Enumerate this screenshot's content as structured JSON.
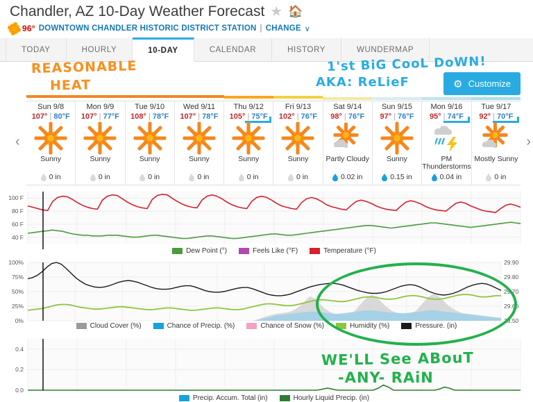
{
  "header": {
    "title": "Chandler, AZ 10-Day Weather Forecast",
    "star_icon": "star-icon",
    "home_icon": "home-icon",
    "current_temp": "96°",
    "station": "DOWNTOWN CHANDLER HISTORIC DISTRICT STATION",
    "separator": "|",
    "change_label": "CHANGE",
    "caret": "∨"
  },
  "tabs": [
    {
      "label": "TODAY",
      "active": false
    },
    {
      "label": "HOURLY",
      "active": false
    },
    {
      "label": "10-DAY",
      "active": true
    },
    {
      "label": "CALENDAR",
      "active": false
    },
    {
      "label": "HISTORY",
      "active": false
    },
    {
      "label": "WUNDERMAP",
      "active": false
    }
  ],
  "customize": {
    "label": "Customize",
    "icon": "gear-icon",
    "color": "#29abe2"
  },
  "nav": {
    "prev": "‹",
    "next": "›"
  },
  "annotations": [
    {
      "id": "reasonable",
      "text": "REASONABLE",
      "color": "#f7901e"
    },
    {
      "id": "heat",
      "text": "HEAT",
      "color": "#f7901e"
    },
    {
      "id": "cooldown",
      "text": "1'st BiG CooL DoWN!",
      "color": "#29abe2"
    },
    {
      "id": "relief",
      "text": "AKA: ReLieF",
      "color": "#29abe2"
    },
    {
      "id": "rain1",
      "text": "WE'LL See ABouT",
      "color": "#22b14c"
    },
    {
      "id": "rain2",
      "text": "-ANY- RAiN",
      "color": "#22b14c"
    }
  ],
  "forecast": {
    "days": [
      {
        "name": "Sun 9/8",
        "high": "107°",
        "low": "80°F",
        "condition": "Sunny",
        "precip": "0 in",
        "icon": "sun-icon",
        "precip_active": false,
        "marked": false
      },
      {
        "name": "Mon 9/9",
        "high": "107°",
        "low": "77°F",
        "condition": "Sunny",
        "precip": "0 in",
        "icon": "sun-icon",
        "precip_active": false,
        "marked": false
      },
      {
        "name": "Tue 9/10",
        "high": "108°",
        "low": "78°F",
        "condition": "Sunny",
        "precip": "0 in",
        "icon": "sun-icon",
        "precip_active": false,
        "marked": false
      },
      {
        "name": "Wed 9/11",
        "high": "107°",
        "low": "78°F",
        "condition": "Sunny",
        "precip": "0 in",
        "icon": "sun-icon",
        "precip_active": false,
        "marked": false
      },
      {
        "name": "Thu 9/12",
        "high": "105°",
        "low": "75°F",
        "condition": "Sunny",
        "precip": "0 in",
        "icon": "sun-icon",
        "precip_active": false,
        "marked": true
      },
      {
        "name": "Fri 9/13",
        "high": "102°",
        "low": "76°F",
        "condition": "Sunny",
        "precip": "0 in",
        "icon": "sun-icon",
        "precip_active": false,
        "marked": false
      },
      {
        "name": "Sat 9/14",
        "high": "98°",
        "low": "76°F",
        "condition": "Partly Cloudy",
        "precip": "0.02 in",
        "icon": "sun-cloud-icon",
        "precip_active": true,
        "marked": false
      },
      {
        "name": "Sun 9/15",
        "high": "97°",
        "low": "76°F",
        "condition": "Sunny",
        "precip": "0.15 in",
        "icon": "sun-icon",
        "precip_active": true,
        "marked": false
      },
      {
        "name": "Mon 9/16",
        "high": "95°",
        "low": "74°F",
        "condition": "PM Thunderstorms",
        "precip": "0.04 in",
        "icon": "thunderstorm-icon",
        "precip_active": true,
        "marked": true
      },
      {
        "name": "Tue 9/17",
        "high": "92°",
        "low": "70°F",
        "condition": "Mostly Sunny",
        "precip": "0 in",
        "icon": "sun-cloud-icon",
        "precip_active": false,
        "marked": true
      }
    ]
  },
  "chart_data": [
    {
      "id": "temperature-chart",
      "type": "line",
      "title": "",
      "xlabel": "",
      "ylabel": "",
      "ylim": [
        30,
        110
      ],
      "yticks": [
        "100 F",
        "80 F",
        "60 F",
        "40 F"
      ],
      "ytick_values": [
        100,
        80,
        60,
        40
      ],
      "grid": true,
      "legend_position": "bottom",
      "legend": [
        {
          "name": "Dew Point (°)",
          "color": "#4a9c3e"
        },
        {
          "name": "Feels Like (°F)",
          "color": "#b248b2"
        },
        {
          "name": "Temperature (°F)",
          "color": "#d6202c"
        }
      ],
      "series": [
        {
          "name": "Temperature (°F)",
          "color": "#d6202c",
          "values": [
            88,
            86,
            84,
            82,
            81,
            95,
            101,
            103,
            102,
            98,
            93,
            89,
            86,
            84,
            83,
            97,
            103,
            105,
            104,
            99,
            94,
            90,
            87,
            85,
            84,
            98,
            104,
            106,
            105,
            100,
            95,
            91,
            88,
            86,
            85,
            97,
            103,
            105,
            103,
            99,
            94,
            90,
            87,
            85,
            84,
            95,
            101,
            103,
            101,
            97,
            92,
            88,
            86,
            84,
            83,
            93,
            99,
            101,
            99,
            95,
            90,
            87,
            85,
            83,
            82,
            89,
            95,
            97,
            95,
            92,
            88,
            85,
            83,
            82,
            81,
            88,
            94,
            96,
            94,
            91,
            87,
            84,
            82,
            81,
            80,
            86,
            92,
            94,
            92,
            88,
            85,
            82,
            80,
            79,
            78,
            84,
            89,
            91,
            89,
            86
          ]
        },
        {
          "name": "Dew Point (°)",
          "color": "#4a9c3e",
          "values": [
            46,
            47,
            48,
            49,
            50,
            51,
            50,
            49,
            47,
            45,
            44,
            43,
            43,
            42,
            42,
            42,
            43,
            43,
            43,
            42,
            41,
            40,
            40,
            41,
            42,
            43,
            43,
            42,
            41,
            40,
            39,
            38,
            38,
            39,
            40,
            41,
            42,
            42,
            41,
            40,
            39,
            38,
            38,
            39,
            40,
            41,
            42,
            43,
            44,
            45,
            45,
            44,
            43,
            43,
            44,
            45,
            46,
            47,
            48,
            49,
            50,
            51,
            52,
            53,
            54,
            55,
            56,
            57,
            58,
            58,
            57,
            56,
            55,
            54,
            55,
            56,
            57,
            58,
            59,
            60,
            61,
            62,
            62,
            61,
            60,
            59,
            58,
            57,
            56,
            55,
            56,
            57,
            58,
            59,
            60,
            61,
            62,
            63,
            62,
            61
          ]
        },
        {
          "name": "Feels Like (°F)",
          "color": "#b248b2",
          "values": []
        }
      ]
    },
    {
      "id": "humidity-pressure-chart",
      "type": "area",
      "title": "",
      "ylim": [
        0,
        100
      ],
      "yticks": [
        "100%",
        "75%",
        "50%",
        "25%",
        "0%"
      ],
      "ytick_values": [
        100,
        75,
        50,
        25,
        0
      ],
      "y2ticks": [
        "29.90",
        "29.80",
        "29.70",
        "29.60",
        "29.50"
      ],
      "y2tick_values": [
        29.9,
        29.8,
        29.7,
        29.6,
        29.5
      ],
      "grid": true,
      "legend_position": "bottom",
      "legend": [
        {
          "name": "Cloud Cover (%)",
          "color": "#9a9a9a"
        },
        {
          "name": "Chance of Precip. (%)",
          "color": "#16a2dc"
        },
        {
          "name": "Chance of Snow (%)",
          "color": "#f4a0c0"
        },
        {
          "name": "Humidity (%)",
          "color": "#8cc63e"
        },
        {
          "name": "Pressure. (in)",
          "color": "#1a1a1a"
        }
      ],
      "series": [
        {
          "name": "Pressure. (in)",
          "color": "#1a1a1a",
          "values": [
            72,
            74,
            78,
            84,
            92,
            98,
            100,
            97,
            90,
            82,
            74,
            68,
            63,
            60,
            58,
            57,
            58,
            60,
            63,
            66,
            68,
            69,
            68,
            66,
            63,
            60,
            57,
            55,
            54,
            54,
            55,
            57,
            59,
            60,
            60,
            58,
            55,
            52,
            50,
            49,
            49,
            50,
            52,
            54,
            56,
            57,
            57,
            55,
            52,
            49,
            46,
            44,
            43,
            43,
            44,
            46,
            49,
            52,
            55,
            58,
            60,
            62,
            63,
            64,
            64,
            63,
            61,
            58,
            55,
            52,
            50,
            48,
            47,
            47,
            48,
            50,
            53,
            56,
            59,
            61,
            62,
            61,
            58,
            54,
            50,
            47,
            45,
            44,
            45,
            47,
            50,
            54,
            58,
            61,
            63,
            64,
            63,
            60,
            56,
            52
          ]
        },
        {
          "name": "Humidity (%)",
          "color": "#8cc63e",
          "values": [
            18,
            19,
            20,
            21,
            23,
            25,
            27,
            28,
            28,
            27,
            25,
            23,
            22,
            21,
            20,
            20,
            21,
            22,
            23,
            24,
            24,
            23,
            22,
            21,
            20,
            19,
            19,
            20,
            21,
            22,
            22,
            21,
            20,
            19,
            18,
            18,
            19,
            20,
            21,
            22,
            22,
            21,
            20,
            19,
            19,
            20,
            22,
            24,
            26,
            28,
            29,
            29,
            28,
            27,
            26,
            26,
            27,
            29,
            31,
            33,
            35,
            36,
            36,
            35,
            34,
            33,
            33,
            34,
            36,
            38,
            40,
            41,
            41,
            40,
            38,
            37,
            37,
            38,
            40,
            42,
            43,
            43,
            42,
            40,
            38,
            37,
            37,
            38,
            40,
            42,
            44,
            45,
            45,
            44,
            42,
            41,
            41,
            42,
            43,
            43
          ]
        },
        {
          "name": "Cloud Cover (%)",
          "color": "#9a9a9a",
          "values": [
            0,
            0,
            0,
            0,
            0,
            0,
            0,
            0,
            0,
            0,
            0,
            0,
            0,
            0,
            0,
            0,
            0,
            0,
            0,
            0,
            0,
            0,
            0,
            0,
            0,
            0,
            0,
            0,
            0,
            0,
            0,
            0,
            0,
            0,
            0,
            0,
            0,
            0,
            0,
            0,
            0,
            0,
            0,
            0,
            0,
            0,
            0,
            0,
            2,
            5,
            8,
            10,
            12,
            13,
            14,
            16,
            20,
            26,
            34,
            42,
            38,
            30,
            22,
            16,
            12,
            10,
            9,
            10,
            14,
            22,
            32,
            40,
            44,
            40,
            32,
            24,
            18,
            14,
            12,
            11,
            12,
            16,
            24,
            34,
            42,
            46,
            42,
            34,
            26,
            20,
            16,
            13,
            12,
            11,
            10,
            9,
            8,
            7,
            6,
            5
          ]
        },
        {
          "name": "Chance of Precip. (%)",
          "color": "#16a2dc",
          "values": [
            0,
            0,
            0,
            0,
            0,
            0,
            0,
            0,
            0,
            0,
            0,
            0,
            0,
            0,
            0,
            0,
            0,
            0,
            0,
            0,
            0,
            0,
            0,
            0,
            0,
            0,
            0,
            0,
            0,
            0,
            0,
            0,
            0,
            0,
            0,
            0,
            0,
            0,
            0,
            0,
            0,
            0,
            0,
            0,
            0,
            0,
            0,
            0,
            1,
            3,
            5,
            7,
            9,
            10,
            11,
            12,
            13,
            14,
            15,
            16,
            16,
            15,
            14,
            13,
            12,
            12,
            13,
            14,
            15,
            16,
            17,
            18,
            18,
            17,
            16,
            15,
            14,
            14,
            13,
            13,
            14,
            15,
            16,
            17,
            18,
            18,
            17,
            16,
            15,
            14,
            13,
            12,
            11,
            10,
            9,
            8,
            7,
            6,
            5,
            4
          ]
        },
        {
          "name": "Chance of Snow (%)",
          "color": "#f4a0c0",
          "values": []
        }
      ]
    },
    {
      "id": "precipitation-chart",
      "type": "area",
      "title": "",
      "ylim": [
        0.0,
        0.5
      ],
      "yticks": [
        "0.4",
        "0.2",
        "0.0"
      ],
      "ytick_values": [
        0.4,
        0.2,
        0.0
      ],
      "grid": true,
      "legend_position": "bottom",
      "legend": [
        {
          "name": "Precip. Accum. Total (in)",
          "color": "#16a2dc"
        },
        {
          "name": "Hourly Liquid Precip. (in)",
          "color": "#2f7d32"
        }
      ],
      "series": [
        {
          "name": "Hourly Liquid Precip. (in)",
          "color": "#2f7d32",
          "values": [
            0,
            0,
            0,
            0,
            0,
            0,
            0,
            0,
            0,
            0,
            0,
            0,
            0,
            0,
            0,
            0,
            0,
            0,
            0,
            0,
            0,
            0,
            0,
            0,
            0,
            0,
            0,
            0,
            0,
            0,
            0,
            0,
            0,
            0,
            0,
            0,
            0,
            0,
            0,
            0,
            0,
            0,
            0,
            0,
            0,
            0,
            0,
            0,
            0,
            0,
            0,
            0,
            0,
            0,
            0,
            0,
            0,
            0,
            0.01,
            0.02,
            0.01,
            0,
            0,
            0,
            0,
            0,
            0,
            0,
            0,
            0.02,
            0.05,
            0.03,
            0,
            0,
            0,
            0,
            0,
            0,
            0,
            0,
            0,
            0.01,
            0.03,
            0.02,
            0,
            0,
            0,
            0,
            0,
            0,
            0,
            0,
            0,
            0,
            0,
            0,
            0,
            0
          ]
        },
        {
          "name": "Precip. Accum. Total (in)",
          "color": "#16a2dc",
          "values": []
        }
      ]
    }
  ]
}
